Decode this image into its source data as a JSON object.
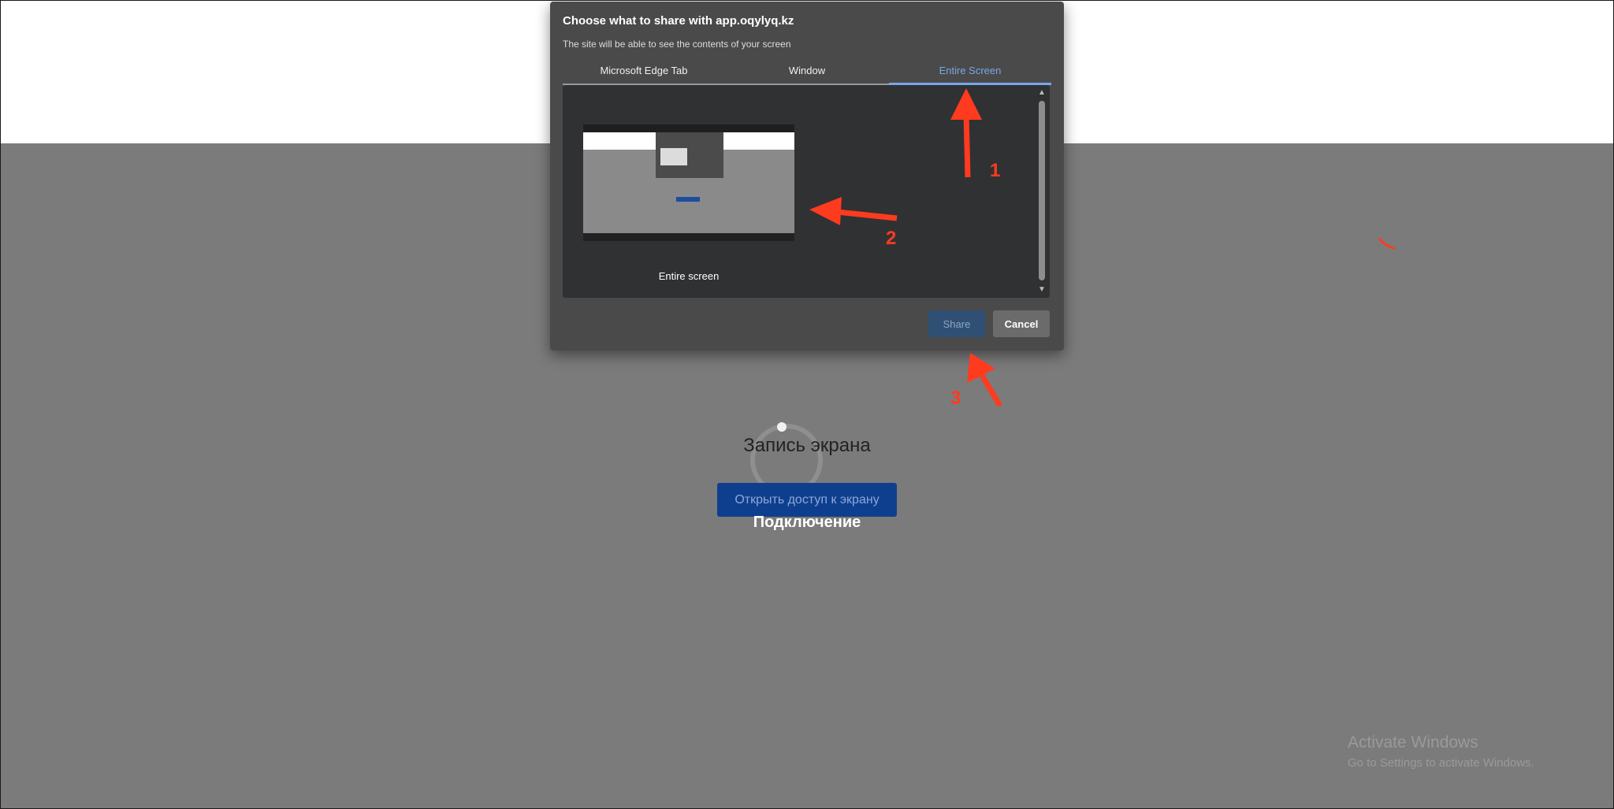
{
  "dialog": {
    "title": "Choose what to share with app.oqylyq.kz",
    "subtitle": "The site will be able to see the contents of your screen",
    "tabs": [
      {
        "label": "Microsoft Edge Tab",
        "active": false
      },
      {
        "label": "Window",
        "active": false
      },
      {
        "label": "Entire Screen",
        "active": true
      }
    ],
    "screen_item_label": "Entire screen",
    "share_label": "Share",
    "cancel_label": "Cancel"
  },
  "page": {
    "title": "Запись экрана",
    "open_access_button": "Открыть доступ к экрану",
    "connecting_text": "Подключение"
  },
  "annotations": [
    "1",
    "2",
    "3"
  ],
  "watermark": {
    "title": "Activate Windows",
    "subtitle": "Go to Settings to activate Windows."
  },
  "colors": {
    "overlay": "#7b7b7b",
    "dialog_bg": "#4a4a4a",
    "accent_blue": "#79a7e8",
    "annotation_red": "#ff3b1f"
  }
}
